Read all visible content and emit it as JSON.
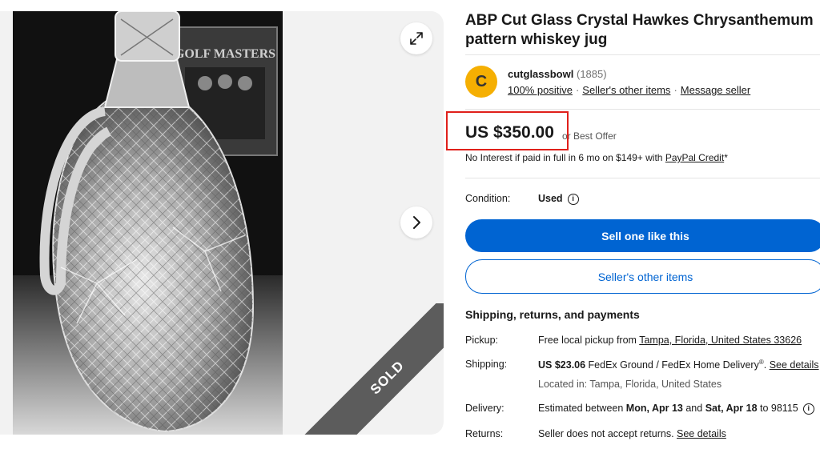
{
  "gallery": {
    "poster_text": "GOLF MASTERS",
    "sold_label": "SOLD",
    "expand_icon": "expand-icon",
    "next_icon": "chevron-right-icon"
  },
  "listing": {
    "title": "ABP Cut Glass Crystal Hawkes Chrysanthemum pattern whiskey jug"
  },
  "seller": {
    "initial": "C",
    "name": "cutglassbowl",
    "feedback_count": "(1885)",
    "positive": "100% positive",
    "other_items_link": "Seller's other items",
    "message_link": "Message seller"
  },
  "price": {
    "amount": "US $350.00",
    "best_offer": "or Best Offer",
    "finance_prefix": "No Interest if paid in full in 6 mo on $149+ with ",
    "finance_link": "PayPal Credit",
    "finance_suffix": "*"
  },
  "condition": {
    "label": "Condition:",
    "value": "Used"
  },
  "buttons": {
    "sell_one": "Sell one like this",
    "other_items": "Seller's other items"
  },
  "shipping": {
    "section_title": "Shipping, returns, and payments",
    "pickup_label": "Pickup:",
    "pickup_prefix": "Free local pickup from ",
    "pickup_location": "Tampa, Florida, United States 33626",
    "shipping_label": "Shipping:",
    "shipping_cost": "US $23.06",
    "shipping_method": " FedEx Ground / FedEx Home Delivery",
    "shipping_reg": "®",
    "shipping_dot": ". ",
    "shipping_details": "See details",
    "located_in": "Located in: Tampa, Florida, United States",
    "delivery_label": "Delivery:",
    "delivery_prefix": "Estimated between ",
    "delivery_start": "Mon, Apr 13",
    "delivery_and": " and ",
    "delivery_end": "Sat, Apr 18",
    "delivery_suffix": " to 98115",
    "returns_label": "Returns:",
    "returns_text": "Seller does not accept returns. ",
    "returns_details": "See details"
  },
  "colors": {
    "primary": "#0064d2",
    "highlight_box": "#e0201b",
    "avatar": "#f5af02",
    "sold_band": "#5c5c5c"
  }
}
